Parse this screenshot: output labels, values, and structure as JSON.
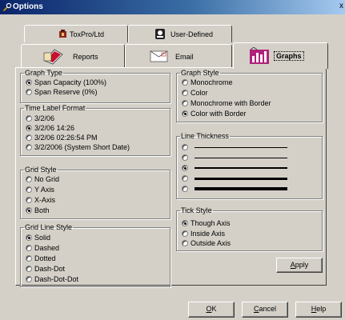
{
  "window": {
    "title": "Options",
    "close_glyph": "x"
  },
  "tabs": {
    "back_row": [
      {
        "label": "ToxPro/Ltd",
        "icon": "toxpro-icon"
      },
      {
        "label": "User-Defined",
        "icon": "user-defined-icon"
      }
    ],
    "front_row": [
      {
        "label": "Reports",
        "icon": "reports-icon"
      },
      {
        "label": "Email",
        "icon": "email-icon"
      },
      {
        "label": "Graphs",
        "icon": "graphs-icon",
        "active": true
      }
    ]
  },
  "graph_type": {
    "title": "Graph Type",
    "options": [
      {
        "label": "Span Capacity (100%)",
        "checked": true
      },
      {
        "label": "Span Reserve (0%)",
        "checked": false
      }
    ]
  },
  "time_label_format": {
    "title": "Time Label Format",
    "options": [
      {
        "label": "3/2/06",
        "checked": false
      },
      {
        "label": "3/2/06 14:26",
        "checked": true
      },
      {
        "label": "3/2/06 02:26:54 PM",
        "checked": false
      },
      {
        "label": "3/2/2006  (System Short Date)",
        "checked": false
      }
    ]
  },
  "grid_style": {
    "title": "Grid Style",
    "options": [
      {
        "label": "No Grid",
        "checked": false
      },
      {
        "label": "Y Axis",
        "checked": false
      },
      {
        "label": "X-Axis",
        "checked": false
      },
      {
        "label": "Both",
        "checked": true
      }
    ]
  },
  "grid_line_style": {
    "title": "Grid Line Style",
    "options": [
      {
        "label": "Solid",
        "checked": true
      },
      {
        "label": "Dashed",
        "checked": false
      },
      {
        "label": "Dotted",
        "checked": false
      },
      {
        "label": "Dash-Dot",
        "checked": false
      },
      {
        "label": "Dash-Dot-Dot",
        "checked": false
      }
    ]
  },
  "graph_style": {
    "title": "Graph Style",
    "options": [
      {
        "label": "Monochrome",
        "checked": false
      },
      {
        "label": "Color",
        "checked": false
      },
      {
        "label": "Monochrome with Border",
        "checked": false
      },
      {
        "label": "Color with Border",
        "checked": true
      }
    ]
  },
  "line_thickness": {
    "title": "Line Thickness",
    "options": [
      {
        "checked": false
      },
      {
        "checked": false
      },
      {
        "checked": true
      },
      {
        "checked": false
      },
      {
        "checked": false
      }
    ]
  },
  "tick_style": {
    "title": "Tick Style",
    "options": [
      {
        "label": "Though Axis",
        "checked": true
      },
      {
        "label": "Inside Axis",
        "checked": false
      },
      {
        "label": "Outside Axis",
        "checked": false
      }
    ]
  },
  "buttons": {
    "apply": {
      "label": "Apply",
      "mnemonic": "A"
    },
    "ok": {
      "label": "OK",
      "mnemonic": "O"
    },
    "cancel": {
      "label": "Cancel",
      "mnemonic": "C"
    },
    "help": {
      "label": "Help",
      "mnemonic": "H"
    }
  }
}
